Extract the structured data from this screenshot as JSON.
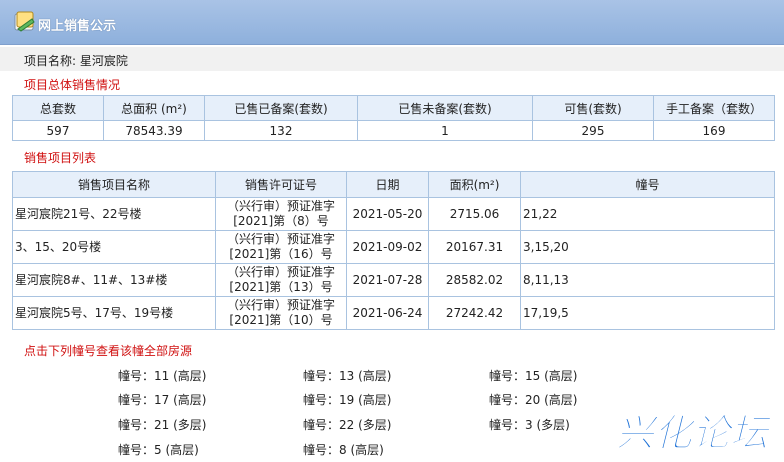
{
  "header": {
    "title": "网上销售公示",
    "accent": "#8eb0dc"
  },
  "project": {
    "name_label": "项目名称:",
    "name": "星河宸院"
  },
  "summary": {
    "section_title": "项目总体销售情况",
    "headers": [
      "总套数",
      "总面积 (m²)",
      "已售已备案(套数)",
      "已售未备案(套数)",
      "可售(套数)",
      "手工备案（套数）"
    ],
    "values": [
      "597",
      "78543.39",
      "132",
      "1",
      "295",
      "169"
    ]
  },
  "list": {
    "section_title": "销售项目列表",
    "headers": [
      "销售项目名称",
      "销售许可证号",
      "日期",
      "面积(m²)",
      "幢号"
    ],
    "rows": [
      {
        "name": "星河宸院21号、22号楼",
        "permit_line1": "（兴行审）预证准字",
        "permit_line2": "[2021]第（8）号",
        "date": "2021-05-20",
        "area": "2715.06",
        "buildings": "21,22"
      },
      {
        "name": "3、15、20号楼",
        "permit_line1": "（兴行审）预证准字",
        "permit_line2": "[2021]第（16）号",
        "date": "2021-09-02",
        "area": "20167.31",
        "buildings": "3,15,20"
      },
      {
        "name": "星河宸院8#、11#、13#楼",
        "permit_line1": "（兴行审）预证准字",
        "permit_line2": "[2021]第（13）号",
        "date": "2021-07-28",
        "area": "28582.02",
        "buildings": "8,11,13"
      },
      {
        "name": "星河宸院5号、17号、19号楼",
        "permit_line1": "（兴行审）预证准字",
        "permit_line2": "[2021]第（10）号",
        "date": "2021-06-24",
        "area": "27242.42",
        "buildings": "17,19,5"
      }
    ]
  },
  "buildings_section": {
    "title": "点击下列幢号查看该幢全部房源",
    "items": [
      "幢号：11 (高层)",
      "幢号：13 (高层)",
      "幢号：15 (高层)",
      "幢号：17 (高层)",
      "幢号：19 (高层)",
      "幢号：20 (高层)",
      "幢号：21 (多层)",
      "幢号：22 (多层)",
      "幢号：3 (多层)",
      "幢号：5 (高层)",
      "幢号：8 (高层)"
    ]
  },
  "watermark": {
    "text": "兴化论坛",
    "color": "#1a6fd6"
  }
}
